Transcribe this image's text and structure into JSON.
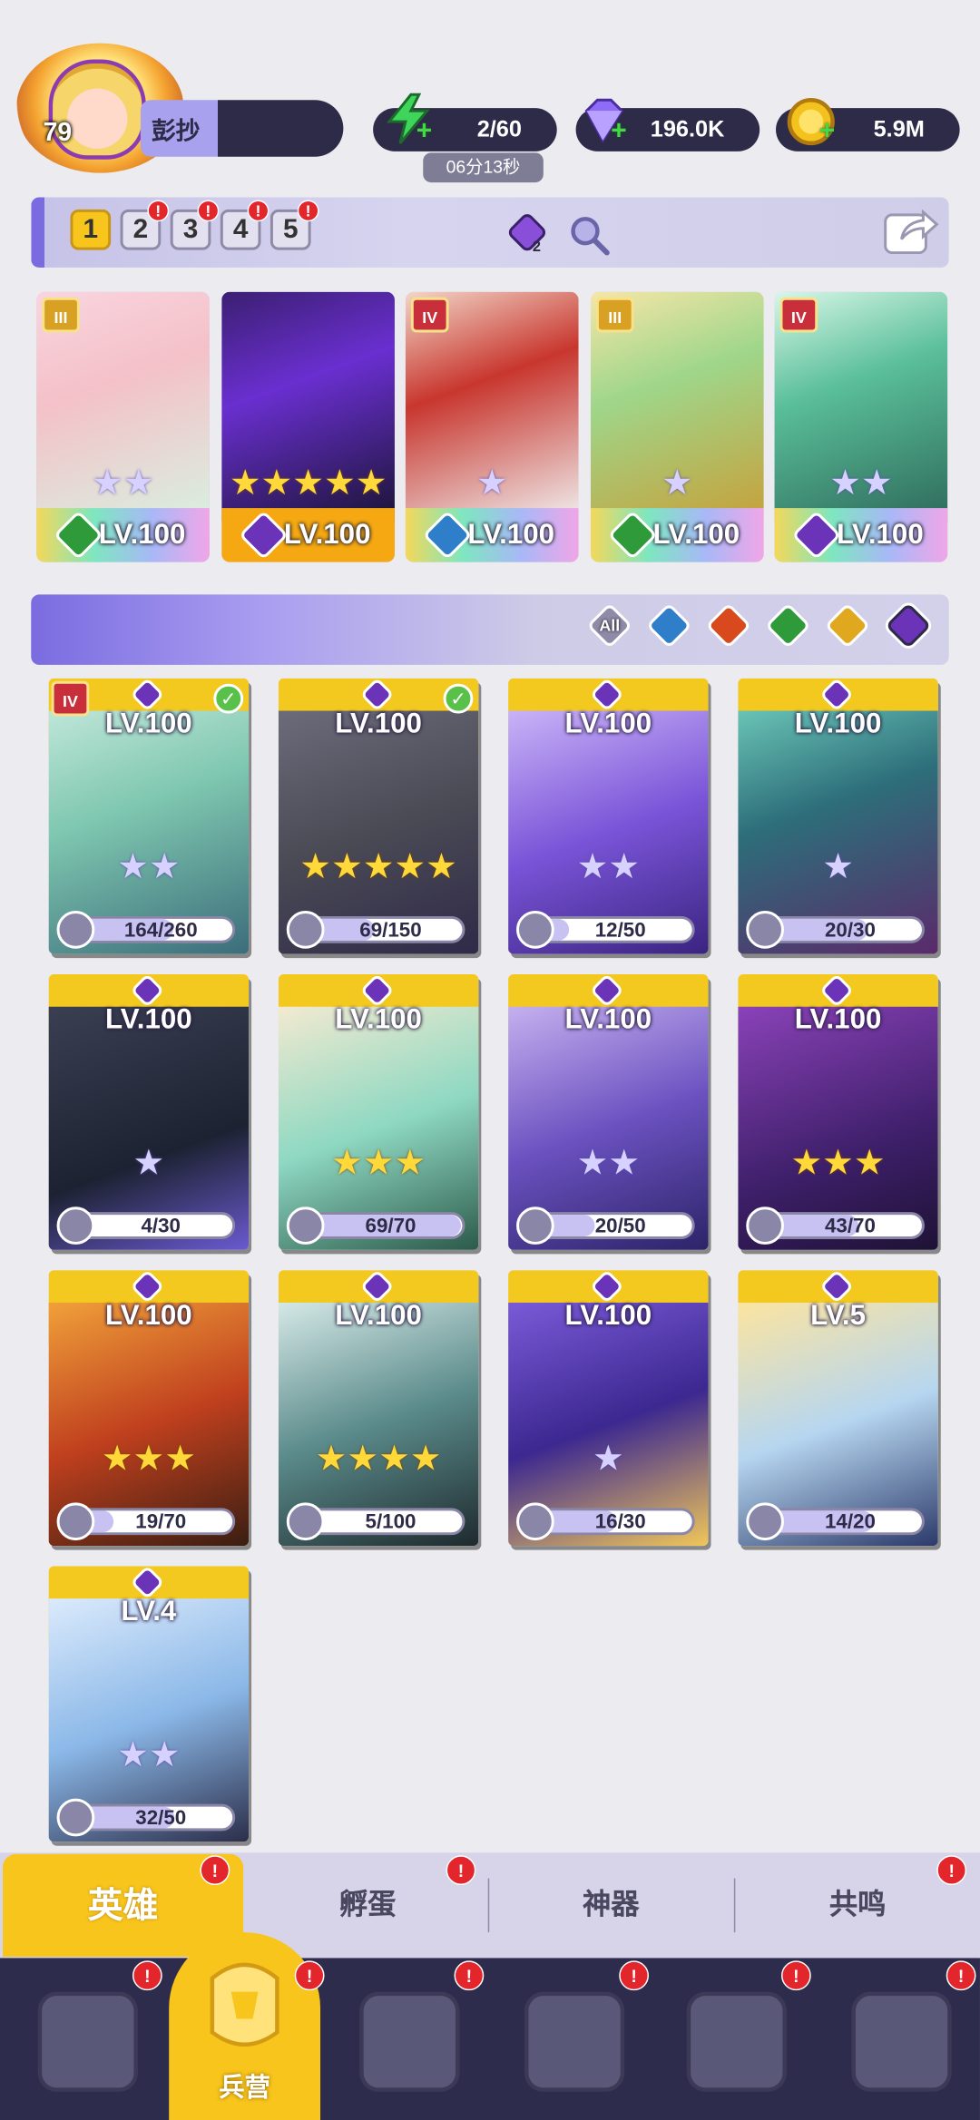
{
  "player": {
    "level": "79",
    "name": "彭抄"
  },
  "resources": {
    "energy": "2/60",
    "energy_timer": "06分13秒",
    "gems": "196.0K",
    "coins": "5.9M"
  },
  "team_tabs": [
    {
      "label": "1",
      "active": true,
      "alert": false
    },
    {
      "label": "2",
      "active": false,
      "alert": true
    },
    {
      "label": "3",
      "active": false,
      "alert": true
    },
    {
      "label": "4",
      "active": false,
      "alert": true
    },
    {
      "label": "5",
      "active": false,
      "alert": true
    }
  ],
  "gem_count": "2",
  "team_slots": [
    {
      "level": "LV.100",
      "rank": "III",
      "element": "nature",
      "stars": "★★"
    },
    {
      "level": "LV.100",
      "rank": "",
      "element": "dark",
      "stars": "★★★★★"
    },
    {
      "level": "LV.100",
      "rank": "IV",
      "element": "water",
      "stars": "★"
    },
    {
      "level": "LV.100",
      "rank": "III",
      "element": "nature",
      "stars": "★"
    },
    {
      "level": "LV.100",
      "rank": "IV",
      "element": "dark",
      "stars": "★★"
    }
  ],
  "filters": [
    {
      "label": "All",
      "element": "all"
    },
    {
      "label": "",
      "element": "water"
    },
    {
      "label": "",
      "element": "fire"
    },
    {
      "label": "",
      "element": "nature"
    },
    {
      "label": "",
      "element": "light"
    },
    {
      "label": "",
      "element": "dark",
      "selected": true
    }
  ],
  "heroes": [
    {
      "level": "LV.100",
      "progress": "164/260",
      "fill": 0.63,
      "stars": "★★",
      "rank": "IV",
      "check": true
    },
    {
      "level": "LV.100",
      "progress": "69/150",
      "fill": 0.46,
      "stars": "★★★★★",
      "rank": "",
      "check": true
    },
    {
      "level": "LV.100",
      "progress": "12/50",
      "fill": 0.24,
      "stars": "★★",
      "rank": "",
      "check": false
    },
    {
      "level": "LV.100",
      "progress": "20/30",
      "fill": 0.67,
      "stars": "★",
      "rank": "",
      "check": false
    },
    {
      "level": "LV.100",
      "progress": "4/30",
      "fill": 0.13,
      "stars": "★",
      "rank": "",
      "check": false
    },
    {
      "level": "LV.100",
      "progress": "69/70",
      "fill": 0.99,
      "stars": "★★★",
      "rank": "",
      "check": false
    },
    {
      "level": "LV.100",
      "progress": "20/50",
      "fill": 0.4,
      "stars": "★★",
      "rank": "",
      "check": false
    },
    {
      "level": "LV.100",
      "progress": "43/70",
      "fill": 0.61,
      "stars": "★★★",
      "rank": "",
      "check": false
    },
    {
      "level": "LV.100",
      "progress": "19/70",
      "fill": 0.27,
      "stars": "★★★",
      "rank": "",
      "check": false
    },
    {
      "level": "LV.100",
      "progress": "5/100",
      "fill": 0.05,
      "stars": "★★★★",
      "rank": "",
      "check": false
    },
    {
      "level": "LV.100",
      "progress": "16/30",
      "fill": 0.53,
      "stars": "★",
      "rank": "",
      "check": false
    },
    {
      "level": "LV.5",
      "progress": "14/20",
      "fill": 0.7,
      "stars": "",
      "rank": "",
      "check": false
    },
    {
      "level": "LV.4",
      "progress": "32/50",
      "fill": 0.64,
      "stars": "★★",
      "rank": "",
      "check": false
    }
  ],
  "sub_tabs": [
    {
      "label": "英雄",
      "active": true,
      "alert": true
    },
    {
      "label": "孵蛋",
      "active": false,
      "alert": true
    },
    {
      "label": "神器",
      "active": false,
      "alert": false
    },
    {
      "label": "共鸣",
      "active": false,
      "alert": true
    }
  ],
  "nav": {
    "active_label": "兵营"
  },
  "colors": {
    "accent_gold": "#f7c51c",
    "panel_dark": "#2d2b47",
    "alert_red": "#e2262b",
    "purple": "#7a6ce0"
  }
}
